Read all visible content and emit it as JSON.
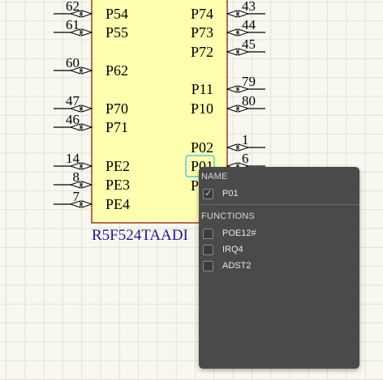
{
  "component": {
    "designator": "R5F524TAADI",
    "left_pins": [
      {
        "name": "P54",
        "number": "62"
      },
      {
        "name": "P55",
        "number": "61"
      },
      {
        "name": "P62",
        "number": "60"
      },
      {
        "name": "P70",
        "number": "47"
      },
      {
        "name": "P71",
        "number": "46"
      },
      {
        "name": "PE2",
        "number": "14"
      },
      {
        "name": "PE3",
        "number": "8"
      },
      {
        "name": "PE4",
        "number": "7"
      }
    ],
    "right_pins": [
      {
        "name": "P74",
        "number": "43"
      },
      {
        "name": "P73",
        "number": "44"
      },
      {
        "name": "P72",
        "number": "45"
      },
      {
        "name": "P11",
        "number": "79"
      },
      {
        "name": "P10",
        "number": "80"
      },
      {
        "name": "P02",
        "number": "1"
      },
      {
        "name": "P01",
        "number": "6"
      },
      {
        "name": "P00",
        "number": ""
      }
    ],
    "body_color": "#ffffb0",
    "body_border_color": "#8b1a1a"
  },
  "popup": {
    "name_section_title": "NAME",
    "name_item": {
      "label": "P01",
      "checked": true
    },
    "functions_section_title": "FUNCTIONS",
    "functions": [
      {
        "label": "POE12#",
        "checked": false
      },
      {
        "label": "IRQ4",
        "checked": false
      },
      {
        "label": "ADST2",
        "checked": false
      }
    ]
  },
  "colors": {
    "popup_bg": "#4a4a4a",
    "highlight": "#5fc3e6",
    "designator": "#1a1a8c"
  }
}
